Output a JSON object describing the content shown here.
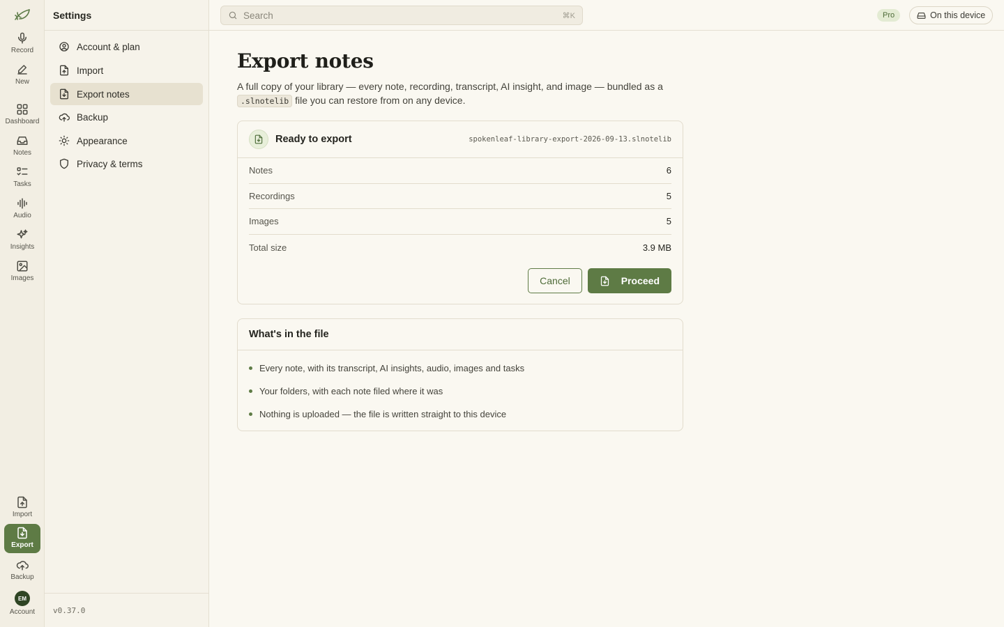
{
  "colors": {
    "accent": "#5e7b45",
    "background": "#faf8f1",
    "pro_badge_bg": "#e3ebd3"
  },
  "rail": {
    "top_items": [
      {
        "label": "Record",
        "icon": "mic-icon"
      },
      {
        "label": "New",
        "icon": "pen-icon"
      },
      {
        "label": "Dashboard",
        "icon": "grid-icon"
      },
      {
        "label": "Notes",
        "icon": "inbox-icon"
      },
      {
        "label": "Tasks",
        "icon": "checklist-icon"
      },
      {
        "label": "Audio",
        "icon": "waveform-icon"
      },
      {
        "label": "Insights",
        "icon": "sparkles-icon"
      },
      {
        "label": "Images",
        "icon": "image-icon"
      }
    ],
    "bottom_items": [
      {
        "label": "Import",
        "icon": "file-import-icon"
      },
      {
        "label": "Export",
        "icon": "file-export-icon",
        "active": true
      },
      {
        "label": "Backup",
        "icon": "cloud-upload-icon"
      },
      {
        "label": "Account",
        "icon": "avatar",
        "initials": "EM"
      }
    ]
  },
  "sidebar": {
    "title": "Settings",
    "items": [
      {
        "label": "Account & plan",
        "icon": "user-circle-icon"
      },
      {
        "label": "Import",
        "icon": "file-import-icon"
      },
      {
        "label": "Export notes",
        "icon": "file-export-icon",
        "active": true
      },
      {
        "label": "Backup",
        "icon": "cloud-upload-icon"
      },
      {
        "label": "Appearance",
        "icon": "sun-icon"
      },
      {
        "label": "Privacy & terms",
        "icon": "shield-icon"
      }
    ],
    "version": "v0.37.0"
  },
  "topbar": {
    "search_placeholder": "Search",
    "search_shortcut": "⌘K",
    "plan_badge": "Pro",
    "device_button": "On this device"
  },
  "main": {
    "title": "Export notes",
    "description_before": "A full copy of your library — every note, recording, transcript, AI insight, and image — bundled as a",
    "description_code": ".slnotelib",
    "description_after": "file you can restore from on any device.",
    "export_card": {
      "title": "Ready to export",
      "file_name": "spokenleaf-library-export-2026-09-13.slnotelib",
      "stats": [
        {
          "label": "Notes",
          "value": "6"
        },
        {
          "label": "Recordings",
          "value": "5"
        },
        {
          "label": "Images",
          "value": "5"
        },
        {
          "label": "Total size",
          "value": "3.9 MB"
        }
      ],
      "cancel_label": "Cancel",
      "proceed_label": "Proceed"
    },
    "info_card": {
      "title": "What's in the file",
      "items": [
        "Every note, with its transcript, AI insights, audio, images and tasks",
        "Your folders, with each note filed where it was",
        "Nothing is uploaded — the file is written straight to this device"
      ]
    }
  }
}
